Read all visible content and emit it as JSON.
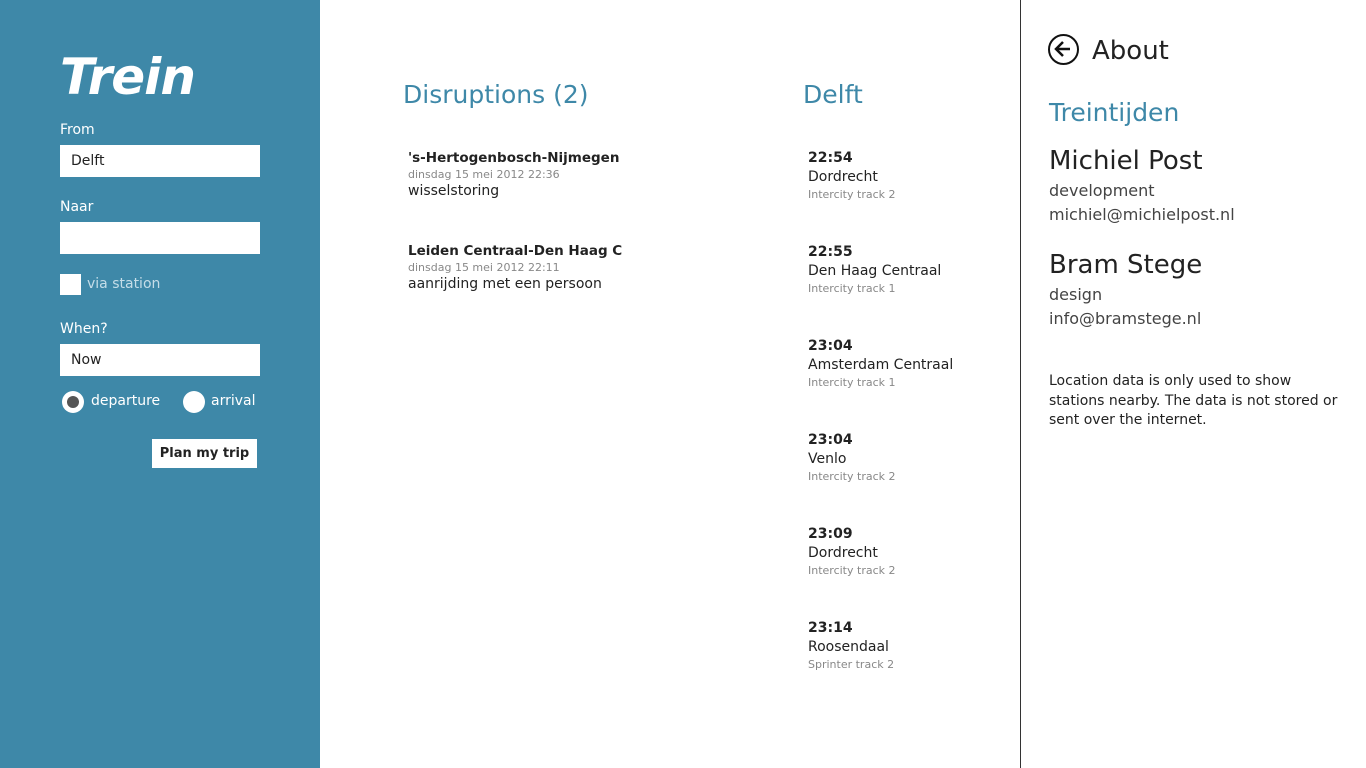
{
  "app": {
    "title": "Trein"
  },
  "planner": {
    "from_label": "From",
    "from_value": "Delft",
    "to_label": "Naar",
    "to_value": "",
    "via_label": "via station",
    "when_label": "When?",
    "when_value": "Now",
    "departure_label": "departure",
    "arrival_label": "arrival",
    "selected_mode": "departure",
    "plan_button": "Plan my trip"
  },
  "disruptions": {
    "title": "Disruptions (2)",
    "items": [
      {
        "route": "'s-Hertogenbosch-Nijmegen",
        "date": "dinsdag 15 mei 2012 22:36",
        "reason": "wisselstoring"
      },
      {
        "route": "Leiden Centraal-Den Haag C",
        "date": "dinsdag 15 mei 2012 22:11",
        "reason": "aanrijding met een persoon"
      }
    ]
  },
  "departures": {
    "station": "Delft",
    "items": [
      {
        "time": "22:54",
        "destination": "Dordrecht",
        "track": "Intercity track 2"
      },
      {
        "time": "22:55",
        "destination": "Den Haag Centraal",
        "track": "Intercity track 1"
      },
      {
        "time": "23:04",
        "destination": "Amsterdam Centraal",
        "track": "Intercity track 1"
      },
      {
        "time": "23:04",
        "destination": "Venlo",
        "track": "Intercity track 2"
      },
      {
        "time": "23:09",
        "destination": "Dordrecht",
        "track": "Intercity track 2"
      },
      {
        "time": "23:14",
        "destination": "Roosendaal",
        "track": "Sprinter track 2"
      }
    ]
  },
  "about": {
    "title": "About",
    "app_name": "Treintijden",
    "people": [
      {
        "name": "Michiel Post",
        "role": "development",
        "email": "michiel@michielpost.nl"
      },
      {
        "name": "Bram Stege",
        "role": "design",
        "email": "info@bramstege.nl"
      }
    ],
    "privacy_note": "Location data is only used to show stations nearby. The data is not stored or sent over the internet."
  },
  "colors": {
    "accent": "#3e88a8",
    "background": "#ffffff"
  },
  "icons": {
    "back": "back-arrow-circle-icon"
  }
}
